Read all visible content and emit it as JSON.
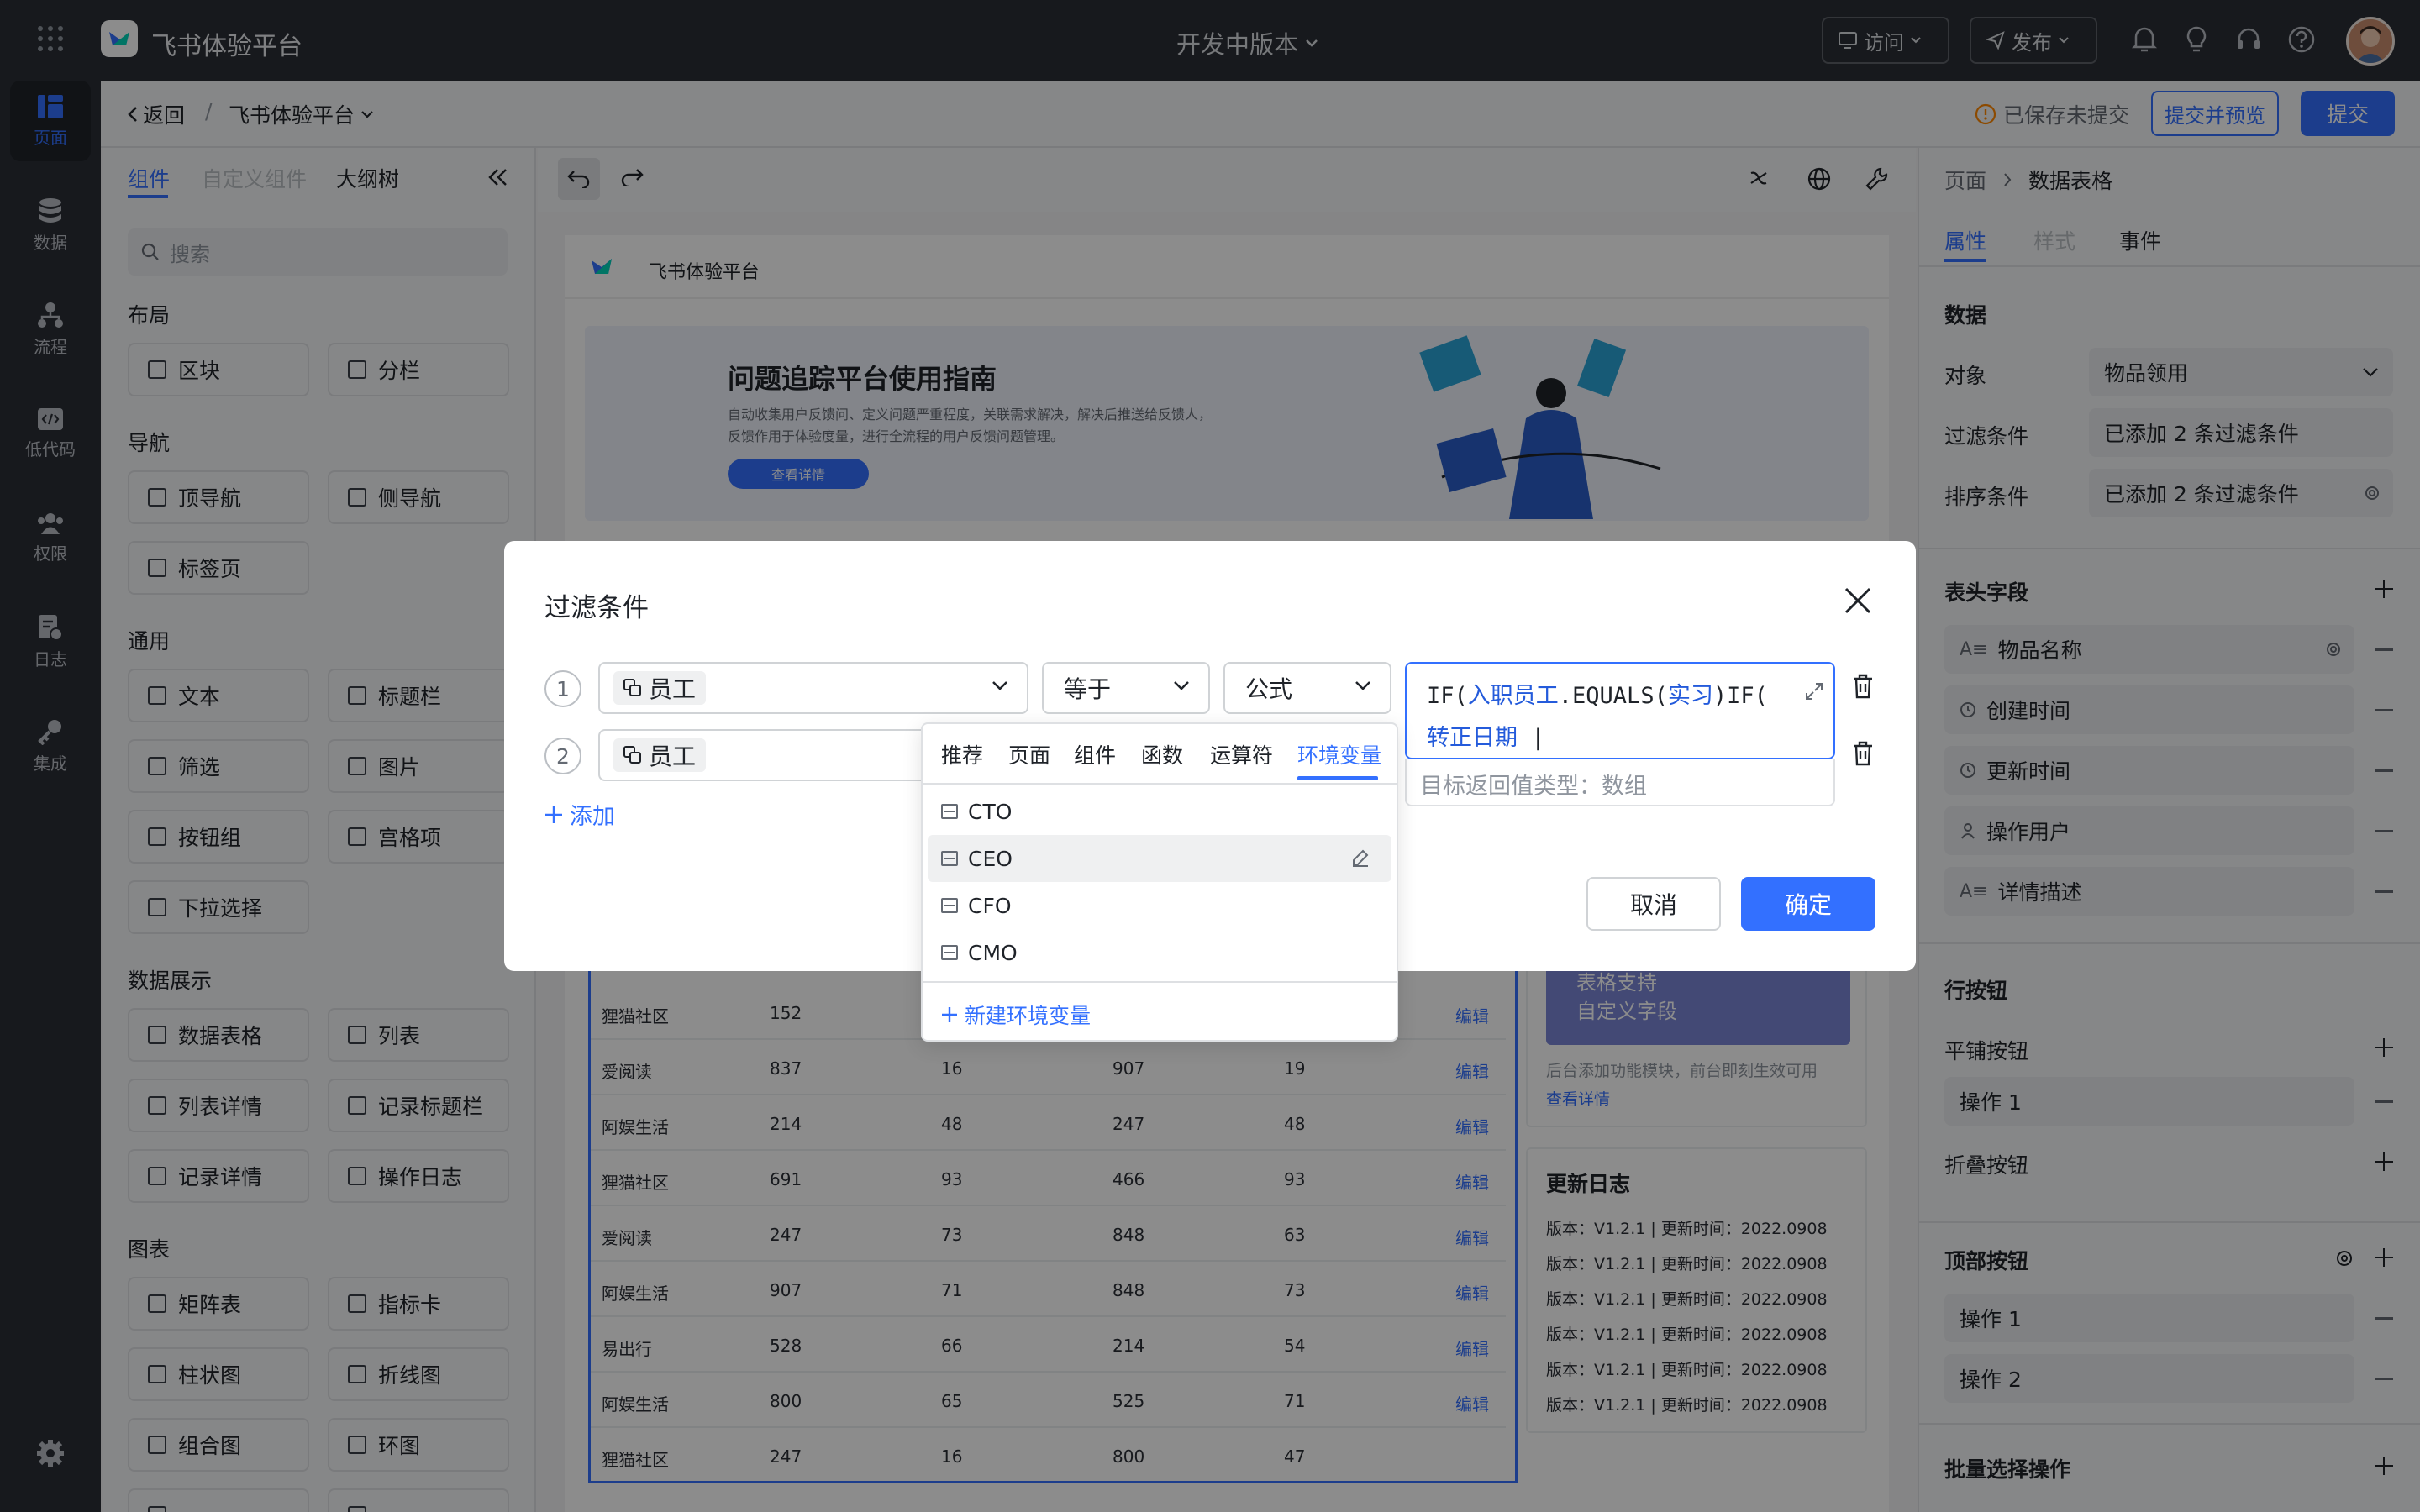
{
  "topbar": {
    "app_title": "飞书体验平台",
    "version_label": "开发中版本",
    "visit_label": "访问",
    "publish_label": "发布"
  },
  "rail": {
    "items": [
      {
        "label": "页面",
        "icon": "page-icon"
      },
      {
        "label": "数据",
        "icon": "database-icon"
      },
      {
        "label": "流程",
        "icon": "flow-icon"
      },
      {
        "label": "低代码",
        "icon": "code-icon"
      },
      {
        "label": "权限",
        "icon": "users-icon"
      },
      {
        "label": "日志",
        "icon": "log-icon"
      },
      {
        "label": "集成",
        "icon": "key-icon"
      }
    ]
  },
  "crumbs": {
    "back_label": "返回",
    "separator": "/",
    "app_label": "飞书体验平台",
    "unsaved_label": "已保存未提交",
    "submit_preview_label": "提交并预览",
    "submit_label": "提交"
  },
  "components_panel": {
    "tabs": [
      "组件",
      "自定义组件",
      "大纲树"
    ],
    "search_placeholder": "搜索",
    "sections": [
      {
        "title": "布局",
        "items": [
          "区块",
          "分栏"
        ]
      },
      {
        "title": "导航",
        "items": [
          "顶导航",
          "侧导航",
          "标签页"
        ]
      },
      {
        "title": "通用",
        "items": [
          "文本",
          "标题栏",
          "筛选",
          "图片",
          "按钮组",
          "宫格项",
          "下拉选择"
        ]
      },
      {
        "title": "数据展示",
        "items": [
          "数据表格",
          "列表",
          "列表详情",
          "记录标题栏",
          "记录详情",
          "操作日志"
        ]
      },
      {
        "title": "图表",
        "items": [
          "矩阵表",
          "指标卡",
          "柱状图",
          "折线图",
          "组合图",
          "环图"
        ]
      }
    ]
  },
  "canvas": {
    "header_title": "飞书体验平台",
    "banner_title": "问题追踪平台使用指南",
    "banner_desc_1": "自动收集用户反馈问、定义问题严重程度，关联需求解决，解决后推送给反馈人，",
    "banner_desc_2": "反馈作用于体验度量，进行全流程的用户反馈问题管理。",
    "banner_button": "查看详情",
    "table_rows": [
      [
        "狸猫社区",
        "152",
        "",
        "",
        "",
        "编辑"
      ],
      [
        "爱阅读",
        "837",
        "16",
        "907",
        "19",
        "编辑"
      ],
      [
        "阿娱生活",
        "214",
        "48",
        "247",
        "48",
        "编辑"
      ],
      [
        "狸猫社区",
        "691",
        "93",
        "466",
        "93",
        "编辑"
      ],
      [
        "爱阅读",
        "247",
        "73",
        "848",
        "63",
        "编辑"
      ],
      [
        "阿娱生活",
        "907",
        "71",
        "848",
        "73",
        "编辑"
      ],
      [
        "易出行",
        "528",
        "66",
        "214",
        "54",
        "编辑"
      ],
      [
        "阿娱生活",
        "800",
        "65",
        "525",
        "71",
        "编辑"
      ],
      [
        "狸猫社区",
        "247",
        "16",
        "800",
        "47",
        ""
      ]
    ],
    "promo_title_1": "表格支持",
    "promo_title_2": "自定义字段",
    "promo_desc": "后台添加功能模块，前台即刻生效可用",
    "promo_link": "查看详情",
    "log_title": "更新日志",
    "log_entries": [
      "版本：V1.2.1 | 更新时间：2022.0908",
      "版本：V1.2.1 | 更新时间：2022.0908",
      "版本：V1.2.1 | 更新时间：2022.0908",
      "版本：V1.2.1 | 更新时间：2022.0908",
      "版本：V1.2.1 | 更新时间：2022.0908",
      "版本：V1.2.1 | 更新时间：2022.0908"
    ]
  },
  "props_panel": {
    "breadcrumb_1": "页面",
    "breadcrumb_2": "数据表格",
    "tabs": [
      "属性",
      "样式",
      "事件"
    ],
    "data_title": "数据",
    "object_label": "对象",
    "object_value": "物品领用",
    "filter_label": "过滤条件",
    "filter_value": "已添加 2 条过滤条件",
    "sort_label": "排序条件",
    "sort_value": "已添加 2 条过滤条件",
    "header_fields_title": "表头字段",
    "header_fields": [
      "物品名称",
      "创建时间",
      "更新时间",
      "操作用户",
      "详情描述"
    ],
    "row_buttons_title": "行按钮",
    "tile_buttons_label": "平铺按钮",
    "tile_buttons": [
      "操作 1"
    ],
    "fold_buttons_label": "折叠按钮",
    "top_buttons_title": "顶部按钮",
    "top_buttons": [
      "操作 1",
      "操作 2"
    ],
    "batch_title": "批量选择操作"
  },
  "modal": {
    "title": "过滤条件",
    "rows": [
      {
        "index": "1",
        "field": "员工",
        "operator": "等于",
        "value_type": "公式"
      },
      {
        "index": "2",
        "field": "员工"
      }
    ],
    "formula": {
      "part1": "IF(",
      "part2": "入职员工",
      "part3": ".EQUALS(",
      "part4": "实习",
      "part5": ")IF(",
      "part6": "转正日期"
    },
    "return_type_label": "目标返回值类型：数组",
    "add_label": "添加",
    "cancel_label": "取消",
    "ok_label": "确定"
  },
  "dropdown": {
    "tabs": [
      "推荐",
      "页面",
      "组件",
      "函数",
      "运算符",
      "环境变量"
    ],
    "active_tab": "环境变量",
    "items": [
      "CTO",
      "CEO",
      "CFO",
      "CMO"
    ],
    "hover_item": "CEO",
    "new_label": "新建环境变量"
  },
  "colors": {
    "accent": "#3370ff",
    "topbar_bg": "#2b2f36"
  }
}
